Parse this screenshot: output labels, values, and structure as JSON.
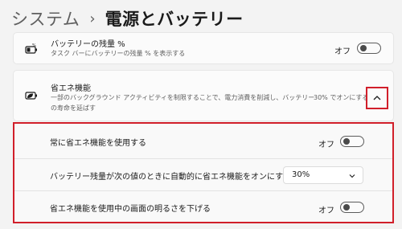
{
  "breadcrumb": {
    "parent": "システム",
    "separator": "›",
    "current": "電源とバッテリー"
  },
  "battery_percentage": {
    "title": "バッテリーの残量 %",
    "description": "タスク バーにバッテリーの残量 % を表示する",
    "state_label": "オフ",
    "enabled": false,
    "icon": "battery-percent-icon"
  },
  "battery_saver": {
    "title": "省エネ機能",
    "description_line1": "一部のバックグラウンド アクティビティを制限することで、電力消費を削減し、バッテリー",
    "description_line2": "の寿命を延ばす",
    "status": "30% でオンにする",
    "icon": "battery-saver-icon",
    "expanded": true,
    "expand_icon": "chevron-up-icon"
  },
  "battery_saver_settings": {
    "always_on": {
      "label": "常に省エネ機能を使用する",
      "state_label": "オフ",
      "enabled": false
    },
    "auto_on": {
      "label": "バッテリー残量が次の値のときに自動的に省エネ機能をオンにする",
      "selected_value": "30%"
    },
    "lower_brightness": {
      "label": "省エネ機能を使用中の画面の明るさを下げる",
      "state_label": "オフ",
      "enabled": false
    }
  },
  "colors": {
    "highlight": "#d11f2a",
    "background": "#f3f3f3",
    "card": "#fbfbfb"
  }
}
